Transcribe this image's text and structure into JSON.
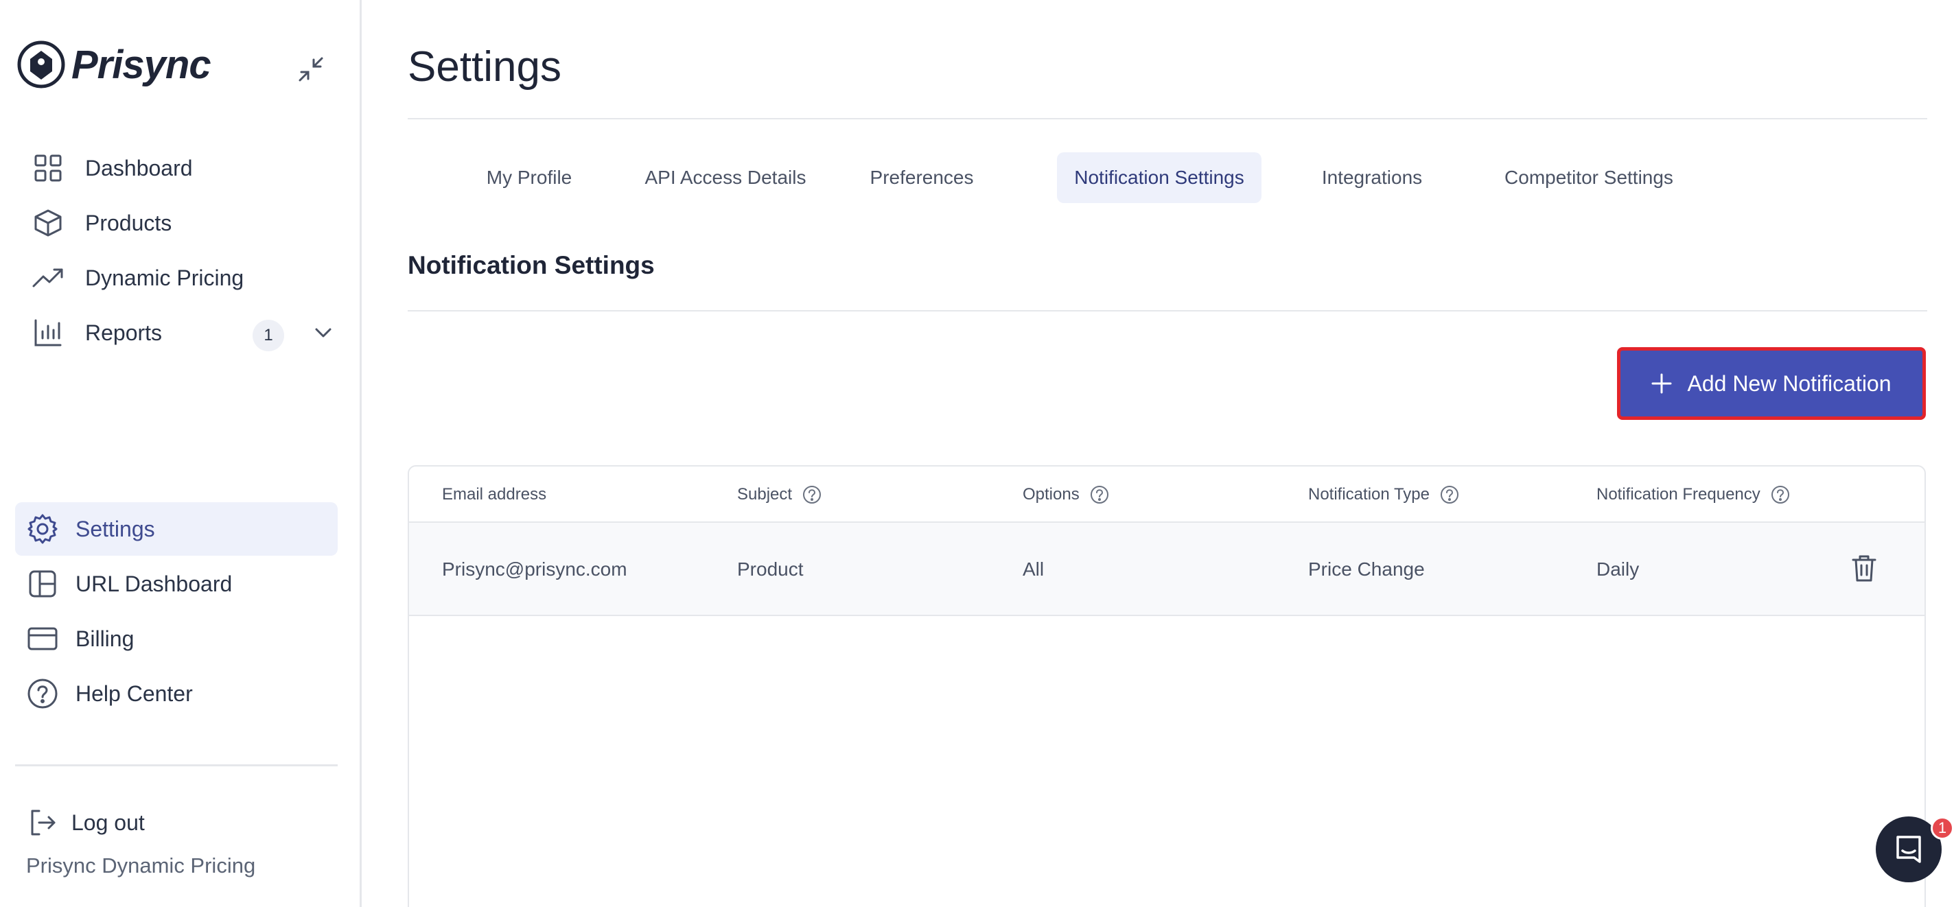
{
  "brand": {
    "name": "Prisync",
    "footer": "Prisync Dynamic Pricing"
  },
  "sidebar": {
    "items": [
      {
        "label": "Dashboard",
        "icon": "grid-icon"
      },
      {
        "label": "Products",
        "icon": "box-icon"
      },
      {
        "label": "Dynamic Pricing",
        "icon": "trending-up-icon"
      },
      {
        "label": "Reports",
        "icon": "bar-chart-icon",
        "badge": "1"
      },
      {
        "label": "Settings",
        "icon": "gear-icon",
        "active": true
      },
      {
        "label": "URL Dashboard",
        "icon": "layout-icon"
      },
      {
        "label": "Billing",
        "icon": "credit-card-icon"
      },
      {
        "label": "Help Center",
        "icon": "help-circle-icon"
      },
      {
        "label": "Log out",
        "icon": "logout-icon"
      }
    ]
  },
  "page": {
    "title": "Settings"
  },
  "tabs": [
    {
      "label": "My Profile"
    },
    {
      "label": "API Access Details"
    },
    {
      "label": "Preferences"
    },
    {
      "label": "Notification Settings",
      "active": true
    },
    {
      "label": "Integrations"
    },
    {
      "label": "Competitor Settings"
    }
  ],
  "section": {
    "title": "Notification Settings",
    "add_button": "Add New Notification"
  },
  "table": {
    "headers": [
      "Email address",
      "Subject",
      "Options",
      "Notification Type",
      "Notification Frequency"
    ],
    "rows": [
      [
        "Prisync@prisync.com",
        "Product",
        "All",
        "Price Change",
        "Daily"
      ]
    ]
  },
  "chat": {
    "badge": "1"
  },
  "colors": {
    "accent": "#4450b4",
    "highlight_border": "#e3242b",
    "active_bg": "#eef1fb",
    "text": "#1f2537"
  }
}
